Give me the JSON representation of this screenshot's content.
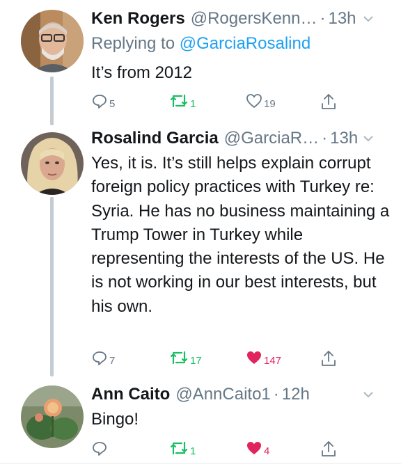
{
  "colors": {
    "accent": "#1da1f2",
    "muted": "#657786",
    "retweet": "#17bf63",
    "like": "#e0245e",
    "thread": "#c4ccd3"
  },
  "tweets": [
    {
      "name": "Ken Rogers",
      "handle": "@RogersKenn…",
      "dot": "·",
      "time": "13h",
      "reply_prefix": "Replying to",
      "reply_handle": "@GarciaRosalind",
      "text": "It’s from 2012",
      "replies": "5",
      "retweets": "1",
      "likes": "19",
      "liked": false
    },
    {
      "name": "Rosalind Garcia",
      "handle": "@GarciaR…",
      "dot": "·",
      "time": "13h",
      "text": "Yes, it is. It’s still helps explain corrupt foreign policy practices with Turkey re: Syria. He has no business maintaining a Trump Tower in Turkey while representing the interests of the US. He is not working in our best interests, but his own.",
      "replies": "7",
      "retweets": "17",
      "likes": "147",
      "liked": true
    },
    {
      "name": "Ann Caito",
      "handle": "@AnnCaito1",
      "dot": "·",
      "time": "12h",
      "text": "Bingo!",
      "replies": "",
      "retweets": "1",
      "likes": "4",
      "liked": true
    }
  ]
}
